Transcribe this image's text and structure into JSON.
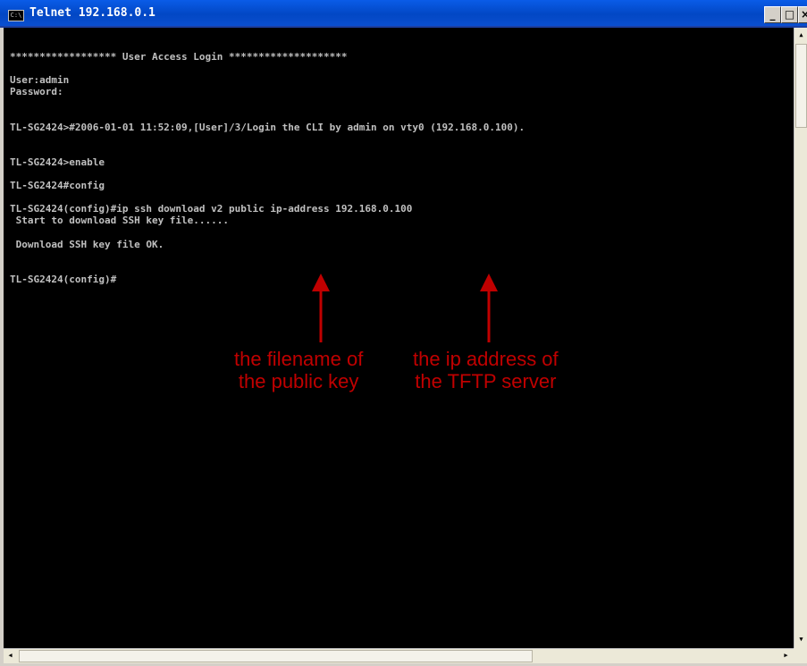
{
  "window": {
    "title": "Telnet 192.168.0.1",
    "icon_label": "C:\\",
    "buttons": {
      "minimize": "_",
      "maximize": "□",
      "close": "×"
    }
  },
  "console": {
    "lines": [
      "****************** User Access Login ********************",
      "",
      "User:admin",
      "Password:",
      "",
      "",
      "TL-SG2424>#2006-01-01 11:52:09,[User]/3/Login the CLI by admin on vty0 (192.168.0.100).",
      "",
      "",
      "TL-SG2424>enable",
      "",
      "TL-SG2424#config",
      "",
      "TL-SG2424(config)#ip ssh download v2 public ip-address 192.168.0.100",
      " Start to download SSH key file......",
      "",
      " Download SSH key file OK.",
      "",
      "",
      "TL-SG2424(config)#"
    ]
  },
  "annotations": {
    "filename": {
      "line1": "the filename of",
      "line2": "the public key"
    },
    "ipaddress": {
      "line1": "the ip address of",
      "line2": "the TFTP server"
    },
    "color": "#c00000"
  },
  "colors": {
    "console_background": "#000000",
    "console_text": "#c0c0c0",
    "titlebar": "#0a5ce8"
  }
}
